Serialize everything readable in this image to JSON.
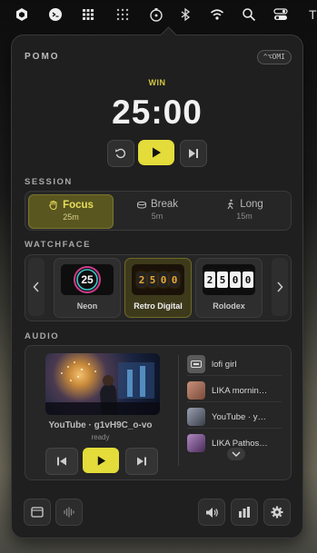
{
  "menubar": {
    "icons": [
      "hexagon-app-icon",
      "terminal-app-icon",
      "grid-app-icon",
      "dots-grid-icon",
      "pomo-timer-icon",
      "bluetooth-icon",
      "wifi-icon",
      "search-icon",
      "control-center-icon"
    ],
    "trailing_text": "T"
  },
  "app": {
    "name": "POMO",
    "shortcut": "^⌥OMI"
  },
  "timer": {
    "status": "WIN",
    "time": "25:00",
    "status_color": "#d4c742"
  },
  "session": {
    "heading": "SESSION",
    "modes": [
      {
        "label": "Focus",
        "duration": "25m",
        "icon": "hand-icon",
        "active": true
      },
      {
        "label": "Break",
        "duration": "5m",
        "icon": "coffee-icon",
        "active": false
      },
      {
        "label": "Long",
        "duration": "15m",
        "icon": "walking-icon",
        "active": false
      }
    ]
  },
  "watchface": {
    "heading": "WATCHFACE",
    "faces": [
      {
        "label": "Neon",
        "preview": "25",
        "active": false
      },
      {
        "label": "Retro Digital",
        "preview": [
          "2",
          "5",
          "0",
          "0"
        ],
        "active": true
      },
      {
        "label": "Rolodex",
        "preview": [
          "2",
          "5",
          "0",
          "0"
        ],
        "active": false
      }
    ]
  },
  "audio": {
    "heading": "AUDIO",
    "video_title": "YouTube · g1vH9C_o-vo",
    "status": "ready",
    "playlist": [
      {
        "title": "lofi girl",
        "color": "#5a5a5a"
      },
      {
        "title": "LIKA mornin…",
        "color": "#b0705a"
      },
      {
        "title": "YouTube · y…",
        "color": "#6a6e7a"
      },
      {
        "title": "LIKA Pathos…",
        "color": "#7a5a8a"
      }
    ]
  },
  "footer": {
    "left": [
      "window-icon",
      "waveform-icon"
    ],
    "right": [
      "volume-icon",
      "bar-chart-icon",
      "gear-icon"
    ]
  },
  "colors": {
    "accent": "#e3dc3a",
    "panel": "#1f1f1f"
  }
}
